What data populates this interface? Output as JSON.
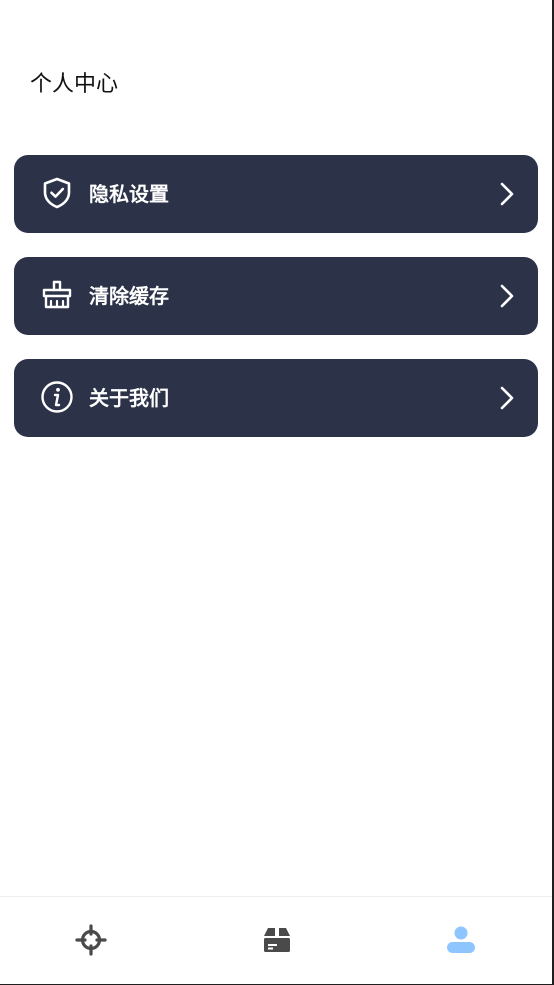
{
  "header": {
    "title": "个人中心"
  },
  "menu": {
    "items": [
      {
        "label": "隐私设置",
        "icon": "shield-check-icon"
      },
      {
        "label": "清除缓存",
        "icon": "broom-basket-icon"
      },
      {
        "label": "关于我们",
        "icon": "info-icon"
      }
    ]
  },
  "tabbar": {
    "tabs": [
      {
        "icon": "crosshair-icon",
        "active": false
      },
      {
        "icon": "box-icon",
        "active": false
      },
      {
        "icon": "user-icon",
        "active": true
      }
    ]
  },
  "colors": {
    "card_bg": "#2c3349",
    "card_text": "#ffffff",
    "tab_inactive": "#4a4a4a",
    "tab_active": "#8ec5ff"
  }
}
